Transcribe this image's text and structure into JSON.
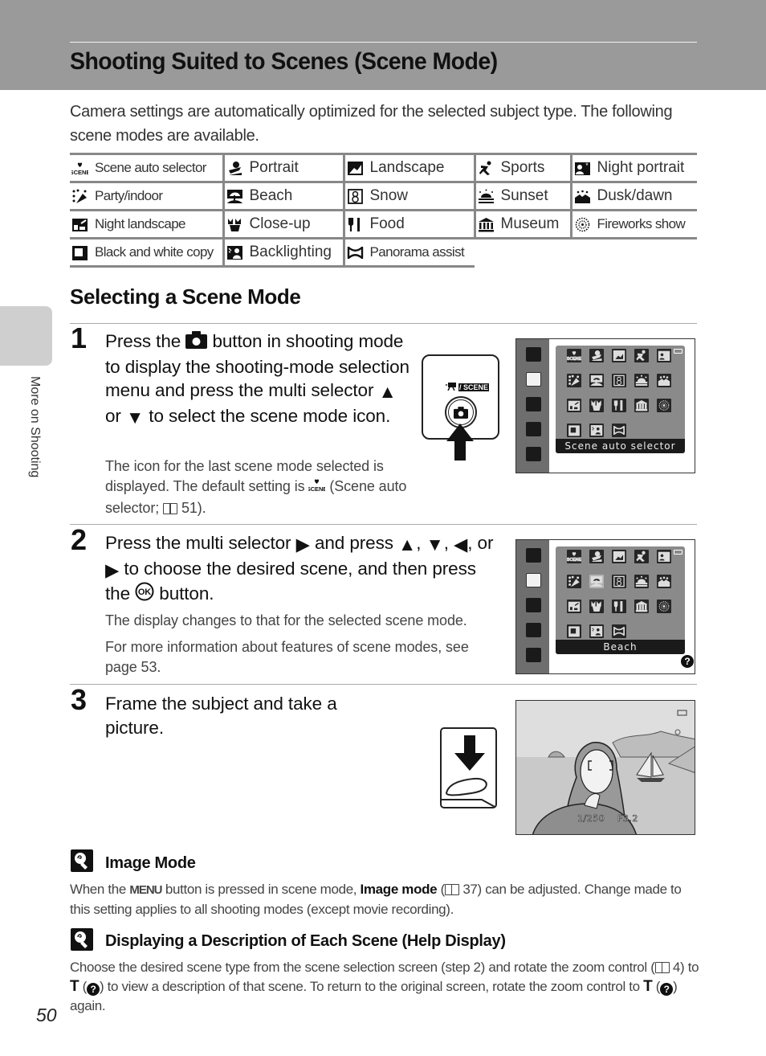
{
  "header": {
    "title": "Shooting Suited to Scenes (Scene Mode)"
  },
  "intro": "Camera settings are automatically optimized for the selected subject type. The following scene modes are available.",
  "scene_table": {
    "rows": [
      [
        {
          "icon": "scene-auto-selector-icon",
          "label": "Scene auto selector"
        },
        {
          "icon": "portrait-icon",
          "label": "Portrait"
        },
        {
          "icon": "landscape-icon",
          "label": "Landscape"
        },
        {
          "icon": "sports-icon",
          "label": "Sports"
        },
        {
          "icon": "night-portrait-icon",
          "label": "Night portrait"
        }
      ],
      [
        {
          "icon": "party-indoor-icon",
          "label": "Party/indoor"
        },
        {
          "icon": "beach-icon",
          "label": "Beach"
        },
        {
          "icon": "snow-icon",
          "label": "Snow"
        },
        {
          "icon": "sunset-icon",
          "label": "Sunset"
        },
        {
          "icon": "dusk-dawn-icon",
          "label": "Dusk/dawn"
        }
      ],
      [
        {
          "icon": "night-landscape-icon",
          "label": "Night landscape"
        },
        {
          "icon": "close-up-icon",
          "label": "Close-up"
        },
        {
          "icon": "food-icon",
          "label": "Food"
        },
        {
          "icon": "museum-icon",
          "label": "Museum"
        },
        {
          "icon": "fireworks-show-icon",
          "label": "Fireworks show"
        }
      ],
      [
        {
          "icon": "black-and-white-copy-icon",
          "label": "Black and white copy"
        },
        {
          "icon": "backlighting-icon",
          "label": "Backlighting"
        },
        {
          "icon": "panorama-assist-icon",
          "label": "Panorama assist"
        }
      ]
    ]
  },
  "section": {
    "title": "Selecting a Scene Mode"
  },
  "steps": [
    {
      "number": "1",
      "main_parts": [
        "Press the",
        "button in shooting mode to display the shooting-mode selection menu and press the multi selector",
        "or",
        "to select the scene mode icon."
      ],
      "note_parts": [
        "The icon for the last scene mode selected is displayed. The default setting is",
        "(Scene auto selector;",
        "51)."
      ],
      "button_diagram": {
        "label": "/ SCENE"
      },
      "screen": {
        "caption": "Scene auto selector"
      }
    },
    {
      "number": "2",
      "main_parts": [
        "Press the multi selector",
        "and press",
        ",",
        ",",
        ",",
        "or",
        "to choose the desired scene, and then press the",
        "button."
      ],
      "notes": [
        "The display changes to that for the selected scene mode.",
        "For more information about features of scene modes, see page 53."
      ],
      "screen": {
        "caption": "Beach",
        "help_icon": "?"
      }
    },
    {
      "number": "3",
      "main": "Frame the subject and take a picture.",
      "screen": {
        "shutter_speed": "1/250",
        "aperture": "F3.2"
      }
    }
  ],
  "notes": [
    {
      "title": "Image Mode",
      "body_parts": [
        "When the",
        "MENU",
        "button is pressed in scene mode,",
        "Image mode",
        "(",
        "37) can be adjusted. Change made to this setting applies to all shooting modes (except movie recording)."
      ]
    },
    {
      "title": "Displaying a Description of Each Scene (Help Display)",
      "body_parts": [
        "Choose the desired scene type from the scene selection screen (step 2) and rotate the zoom control (",
        "4) to",
        "T",
        "(",
        ") to view a description of that scene. To return to the original screen, rotate the zoom control to",
        "T",
        "(",
        ") again."
      ]
    }
  ],
  "side_tab": {
    "label": "More on Shooting"
  },
  "page_number": "50"
}
